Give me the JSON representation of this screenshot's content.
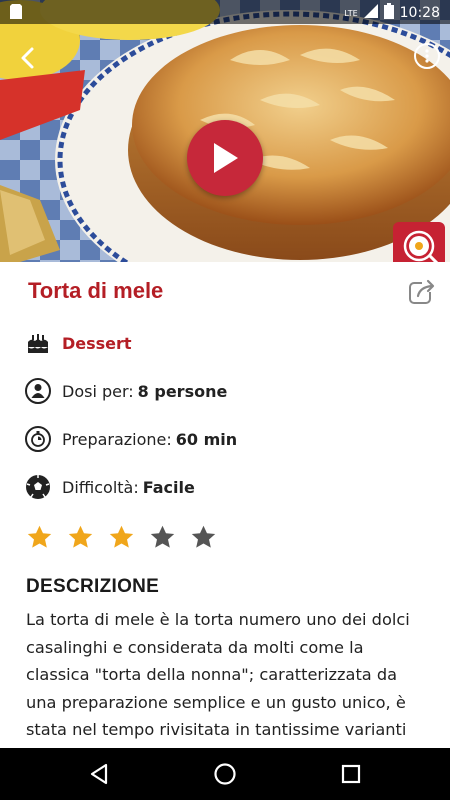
{
  "status_bar": {
    "time": "10:28",
    "network": "LTE"
  },
  "recipe": {
    "title": "Torta di mele",
    "category": "Dessert",
    "servings_label": "Dosi per:",
    "servings_value": "8 persone",
    "prep_label": "Preparazione:",
    "prep_value": "60 min",
    "difficulty_label": "Difficoltà:",
    "difficulty_value": "Facile",
    "rating": 3,
    "rating_max": 5
  },
  "description": {
    "heading": "DESCRIZIONE",
    "text": "La torta di mele è la torta numero uno dei dolci casalinghi e considerata da molti come la classica \"torta della nonna\"; caratterizzata da una preparazione semplice e un gusto unico, è stata nel tempo rivisitata in tantissime varianti"
  },
  "colors": {
    "accent": "#b41e25",
    "star_on": "#f0a61b",
    "star_off": "#555555"
  },
  "icons": {
    "back": "chevron-left-icon",
    "more": "more-vert-icon",
    "play": "play-icon",
    "share": "share-icon",
    "category": "cake-icon",
    "servings": "person-icon",
    "prep": "timer-icon",
    "difficulty": "ball-icon"
  }
}
